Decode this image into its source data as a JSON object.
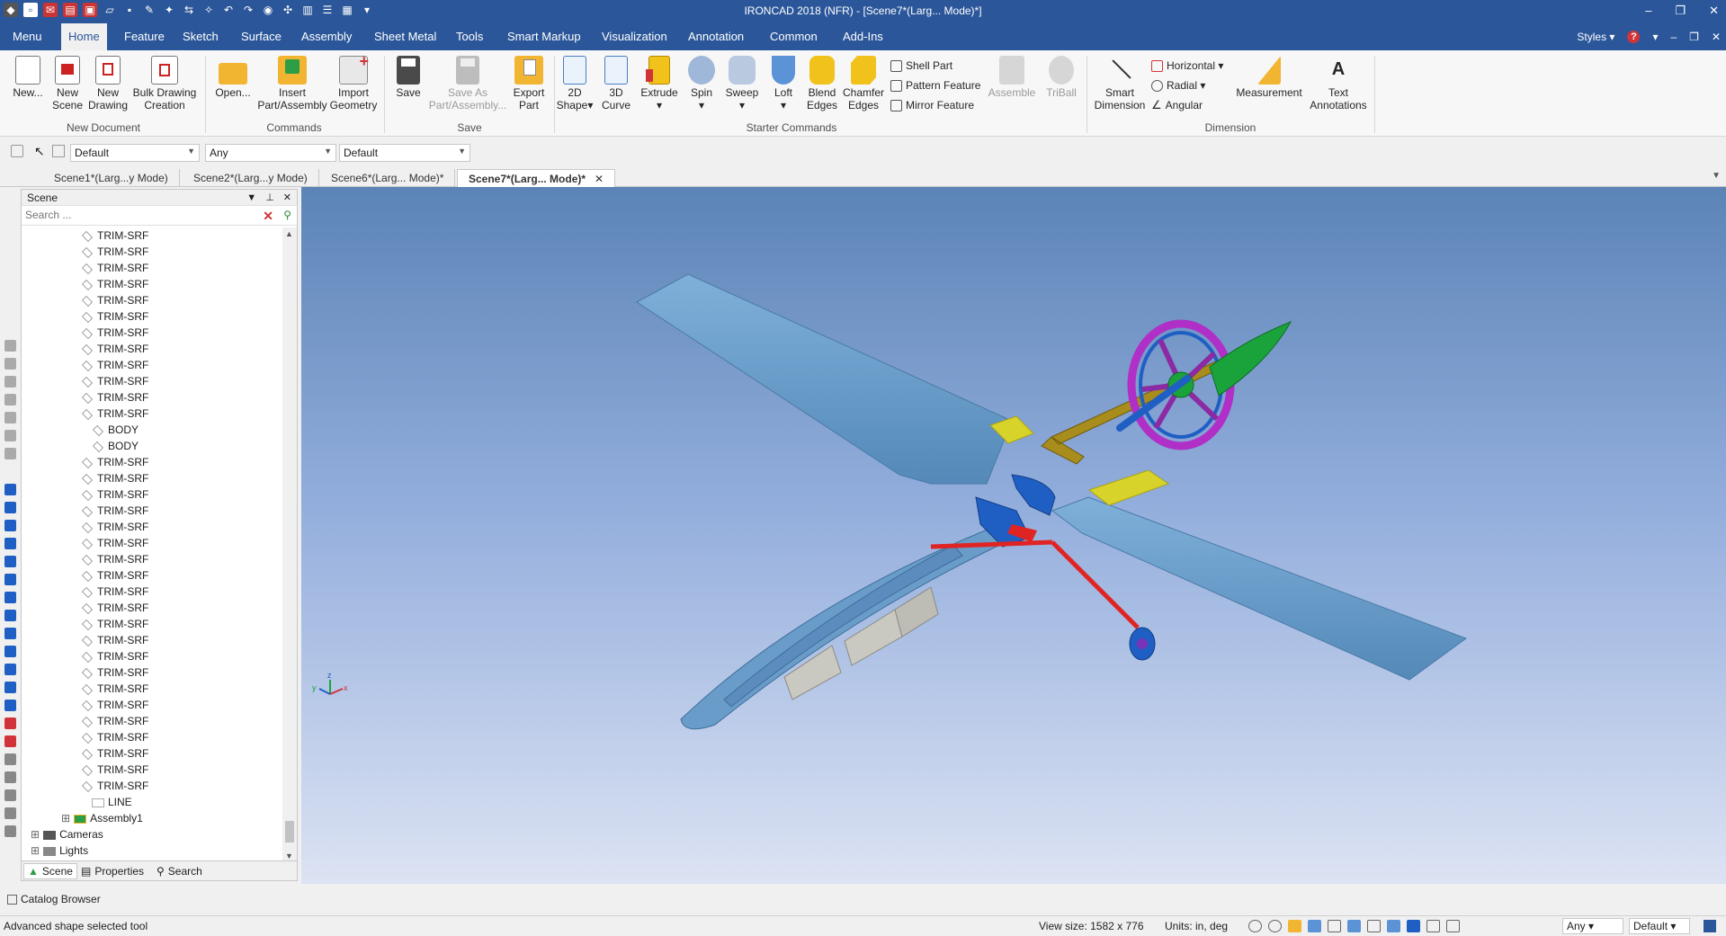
{
  "app": {
    "title": "IRONCAD 2018 (NFR) - [Scene7*(Larg... Mode)*]",
    "window_controls": [
      "–",
      "❐",
      "✕"
    ]
  },
  "menu": {
    "tabs": [
      "Menu",
      "Home",
      "Feature",
      "Sketch",
      "Surface",
      "Assembly",
      "Sheet Metal",
      "Tools",
      "Smart Markup",
      "Visualization",
      "Annotation",
      "Common",
      "Add-Ins"
    ],
    "active": "Home",
    "styles_label": "Styles",
    "right_controls": [
      "–",
      "❐",
      "✕"
    ]
  },
  "ribbon": {
    "new_document": {
      "label": "New Document",
      "buttons": [
        "New...",
        "New\nScene",
        "New\nDrawing",
        "Bulk Drawing\nCreation"
      ]
    },
    "commands": {
      "label": "Commands",
      "buttons": [
        "Open...",
        "Insert\nPart/Assembly",
        "Import\nGeometry"
      ]
    },
    "save": {
      "label": "Save",
      "buttons": [
        "Save",
        "Save As\nPart/Assembly...",
        "Export\nPart"
      ]
    },
    "starter": {
      "label": "Starter Commands",
      "buttons": [
        "2D\nShape▾",
        "3D\nCurve",
        "Extrude\n▾",
        "Spin\n▾",
        "Sweep\n▾",
        "Loft\n▾",
        "Blend\nEdges",
        "Chamfer\nEdges"
      ],
      "small_buttons": [
        "Shell Part",
        "Pattern Feature",
        "Mirror Feature"
      ],
      "disabled_buttons": [
        "Assemble",
        "TriBall"
      ]
    },
    "dimension": {
      "label": "Dimension",
      "buttons": [
        "Smart\nDimension"
      ],
      "small_buttons": [
        "Horizontal ▾",
        "Radial ▾",
        "Angular"
      ],
      "extra_buttons": [
        "Measurement",
        "Text\nAnnotations"
      ]
    }
  },
  "selection_bar": {
    "combo1": "Default",
    "combo2": "Any",
    "combo3": "Default"
  },
  "doc_tabs": [
    "Scene1*(Larg...y Mode)",
    "Scene2*(Larg...y Mode)",
    "Scene6*(Larg... Mode)*",
    "Scene7*(Larg... Mode)*"
  ],
  "scene_panel": {
    "title": "Scene",
    "search_placeholder": "Search ...",
    "tree": [
      "TRIM-SRF",
      "TRIM-SRF",
      "TRIM-SRF",
      "TRIM-SRF",
      "TRIM-SRF",
      "TRIM-SRF",
      "TRIM-SRF",
      "TRIM-SRF",
      "TRIM-SRF",
      "TRIM-SRF",
      "TRIM-SRF",
      "TRIM-SRF",
      "BODY",
      "BODY",
      "TRIM-SRF",
      "TRIM-SRF",
      "TRIM-SRF",
      "TRIM-SRF",
      "TRIM-SRF",
      "TRIM-SRF",
      "TRIM-SRF",
      "TRIM-SRF",
      "TRIM-SRF",
      "TRIM-SRF",
      "TRIM-SRF",
      "TRIM-SRF",
      "TRIM-SRF",
      "TRIM-SRF",
      "TRIM-SRF",
      "TRIM-SRF",
      "TRIM-SRF",
      "TRIM-SRF",
      "TRIM-SRF",
      "TRIM-SRF",
      "TRIM-SRF",
      "LINE",
      "Assembly1",
      "Cameras",
      "Lights"
    ],
    "tabs": [
      "Scene",
      "Properties",
      "Search"
    ]
  },
  "catalog_label": "Catalog Browser",
  "status": {
    "message": "Advanced shape selected tool",
    "view_size": "View size: 1582 x 776",
    "units": "Units: in, deg",
    "combo_any": "Any",
    "combo_default": "Default"
  },
  "colors": {
    "titlebar": "#2b579a",
    "viewport_top": "#5b84b6",
    "viewport_bottom": "#dce3f3",
    "wing": "#6a9cc9",
    "yellow": "#d8d32a",
    "blue_part": "#1f5fc4",
    "purple": "#b02fc7",
    "green": "#1aa33a",
    "red": "#e02424"
  },
  "icons": [
    "new-icon",
    "folder-icon",
    "save-icon",
    "extrude-icon",
    "shell-icon",
    "triball-icon",
    "measure-icon",
    "text-icon",
    "axis-triad-icon"
  ]
}
